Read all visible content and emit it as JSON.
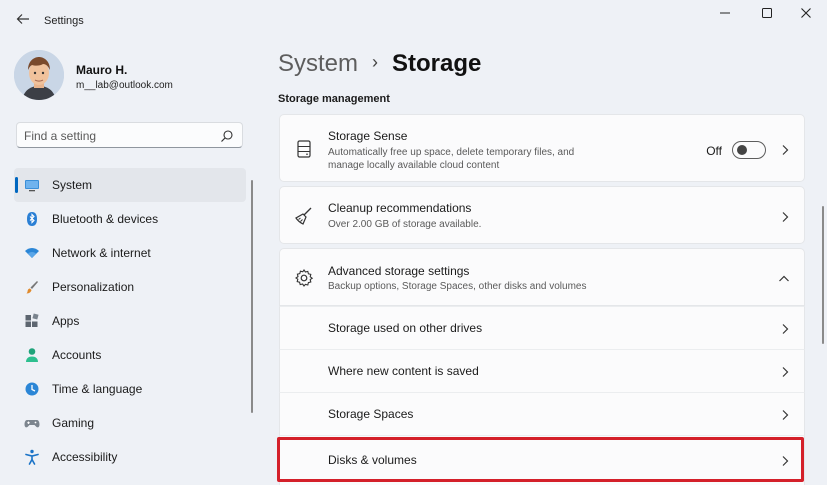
{
  "titlebar": {
    "app_title": "Settings",
    "back_icon": "back-arrow-icon",
    "controls": [
      "minimize-icon",
      "maximize-icon",
      "close-icon"
    ]
  },
  "profile": {
    "name": "Mauro H.",
    "email": "m__lab@outlook.com"
  },
  "search": {
    "placeholder": "Find a setting",
    "value": ""
  },
  "sidebar": {
    "items": [
      {
        "label": "System",
        "icon": "system-icon",
        "active": true
      },
      {
        "label": "Bluetooth & devices",
        "icon": "bluetooth-icon"
      },
      {
        "label": "Network & internet",
        "icon": "wifi-icon"
      },
      {
        "label": "Personalization",
        "icon": "brush-icon"
      },
      {
        "label": "Apps",
        "icon": "apps-icon"
      },
      {
        "label": "Accounts",
        "icon": "person-icon"
      },
      {
        "label": "Time & language",
        "icon": "clock-globe-icon"
      },
      {
        "label": "Gaming",
        "icon": "gamepad-icon"
      },
      {
        "label": "Accessibility",
        "icon": "accessibility-icon"
      }
    ]
  },
  "breadcrumb": {
    "parent": "System",
    "separator": "›",
    "current": "Storage"
  },
  "main": {
    "section_title": "Storage management",
    "storage_sense": {
      "title": "Storage Sense",
      "desc_line1": "Automatically free up space, delete temporary files, and",
      "desc_line2": "manage locally available cloud content",
      "toggle_state": "Off",
      "icon": "storage-drive-icon"
    },
    "cleanup": {
      "title": "Cleanup recommendations",
      "desc": "Over 2.00 GB of storage available.",
      "icon": "broom-icon"
    },
    "advanced": {
      "title": "Advanced storage settings",
      "desc": "Backup options, Storage Spaces, other disks and volumes",
      "icon": "gear-icon",
      "expanded": true
    },
    "advanced_items": [
      {
        "label": "Storage used on other drives"
      },
      {
        "label": "Where new content is saved"
      },
      {
        "label": "Storage Spaces"
      },
      {
        "label": "Disks & volumes",
        "highlighted": true
      }
    ]
  },
  "colors": {
    "accent": "#0067c0",
    "highlight_border": "#d4202a",
    "window_bg": "#eef1f6",
    "card_bg": "#fbfbfc"
  }
}
